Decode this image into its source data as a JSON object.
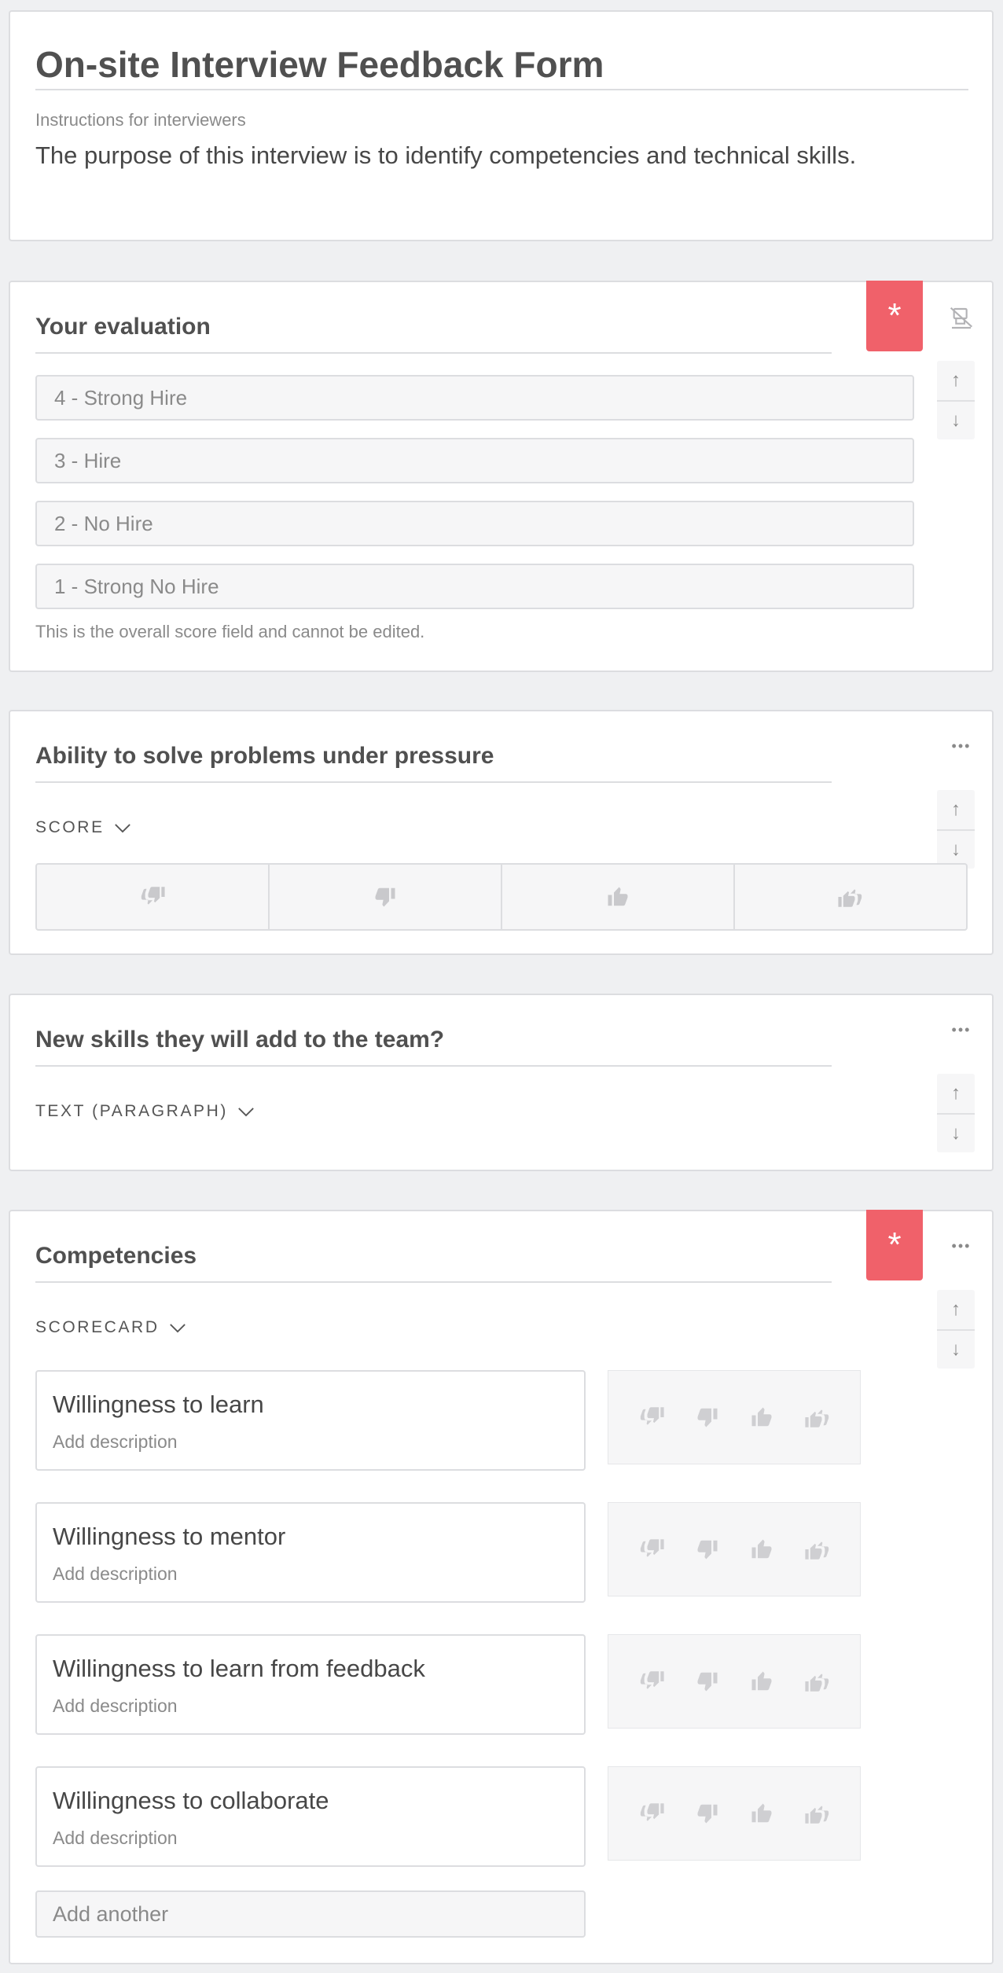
{
  "header": {
    "title": "On-site Interview Feedback Form",
    "instructions_label": "Instructions for interviewers",
    "instructions_text": "The purpose of this interview is to identify competencies and technical skills."
  },
  "evaluation": {
    "title": "Your evaluation",
    "required_mark": "*",
    "options": [
      "4 - Strong Hire",
      "3 - Hire",
      "2 - No Hire",
      "1 - Strong No Hire"
    ],
    "helper": "This is the overall score field and cannot be edited."
  },
  "problem_solving": {
    "title": "Ability to solve problems under pressure",
    "type_label": "SCORE",
    "more_label": "•••"
  },
  "new_skills": {
    "title": "New skills they will add to the team?",
    "type_label": "TEXT (PARAGRAPH)",
    "more_label": "•••"
  },
  "competencies": {
    "title": "Competencies",
    "required_mark": "*",
    "type_label": "SCORECARD",
    "more_label": "•••",
    "items": [
      {
        "title": "Willingness to learn",
        "description": "Add description"
      },
      {
        "title": "Willingness to mentor",
        "description": "Add description"
      },
      {
        "title": "Willingness to learn from feedback",
        "description": "Add description"
      },
      {
        "title": "Willingness to collaborate",
        "description": "Add description"
      }
    ],
    "add_another": "Add another"
  },
  "controls": {
    "move_up": "↑",
    "move_down": "↓"
  },
  "colors": {
    "required": "#f0616a",
    "background": "#eff0f2",
    "icon_muted": "#c9c9cc"
  }
}
